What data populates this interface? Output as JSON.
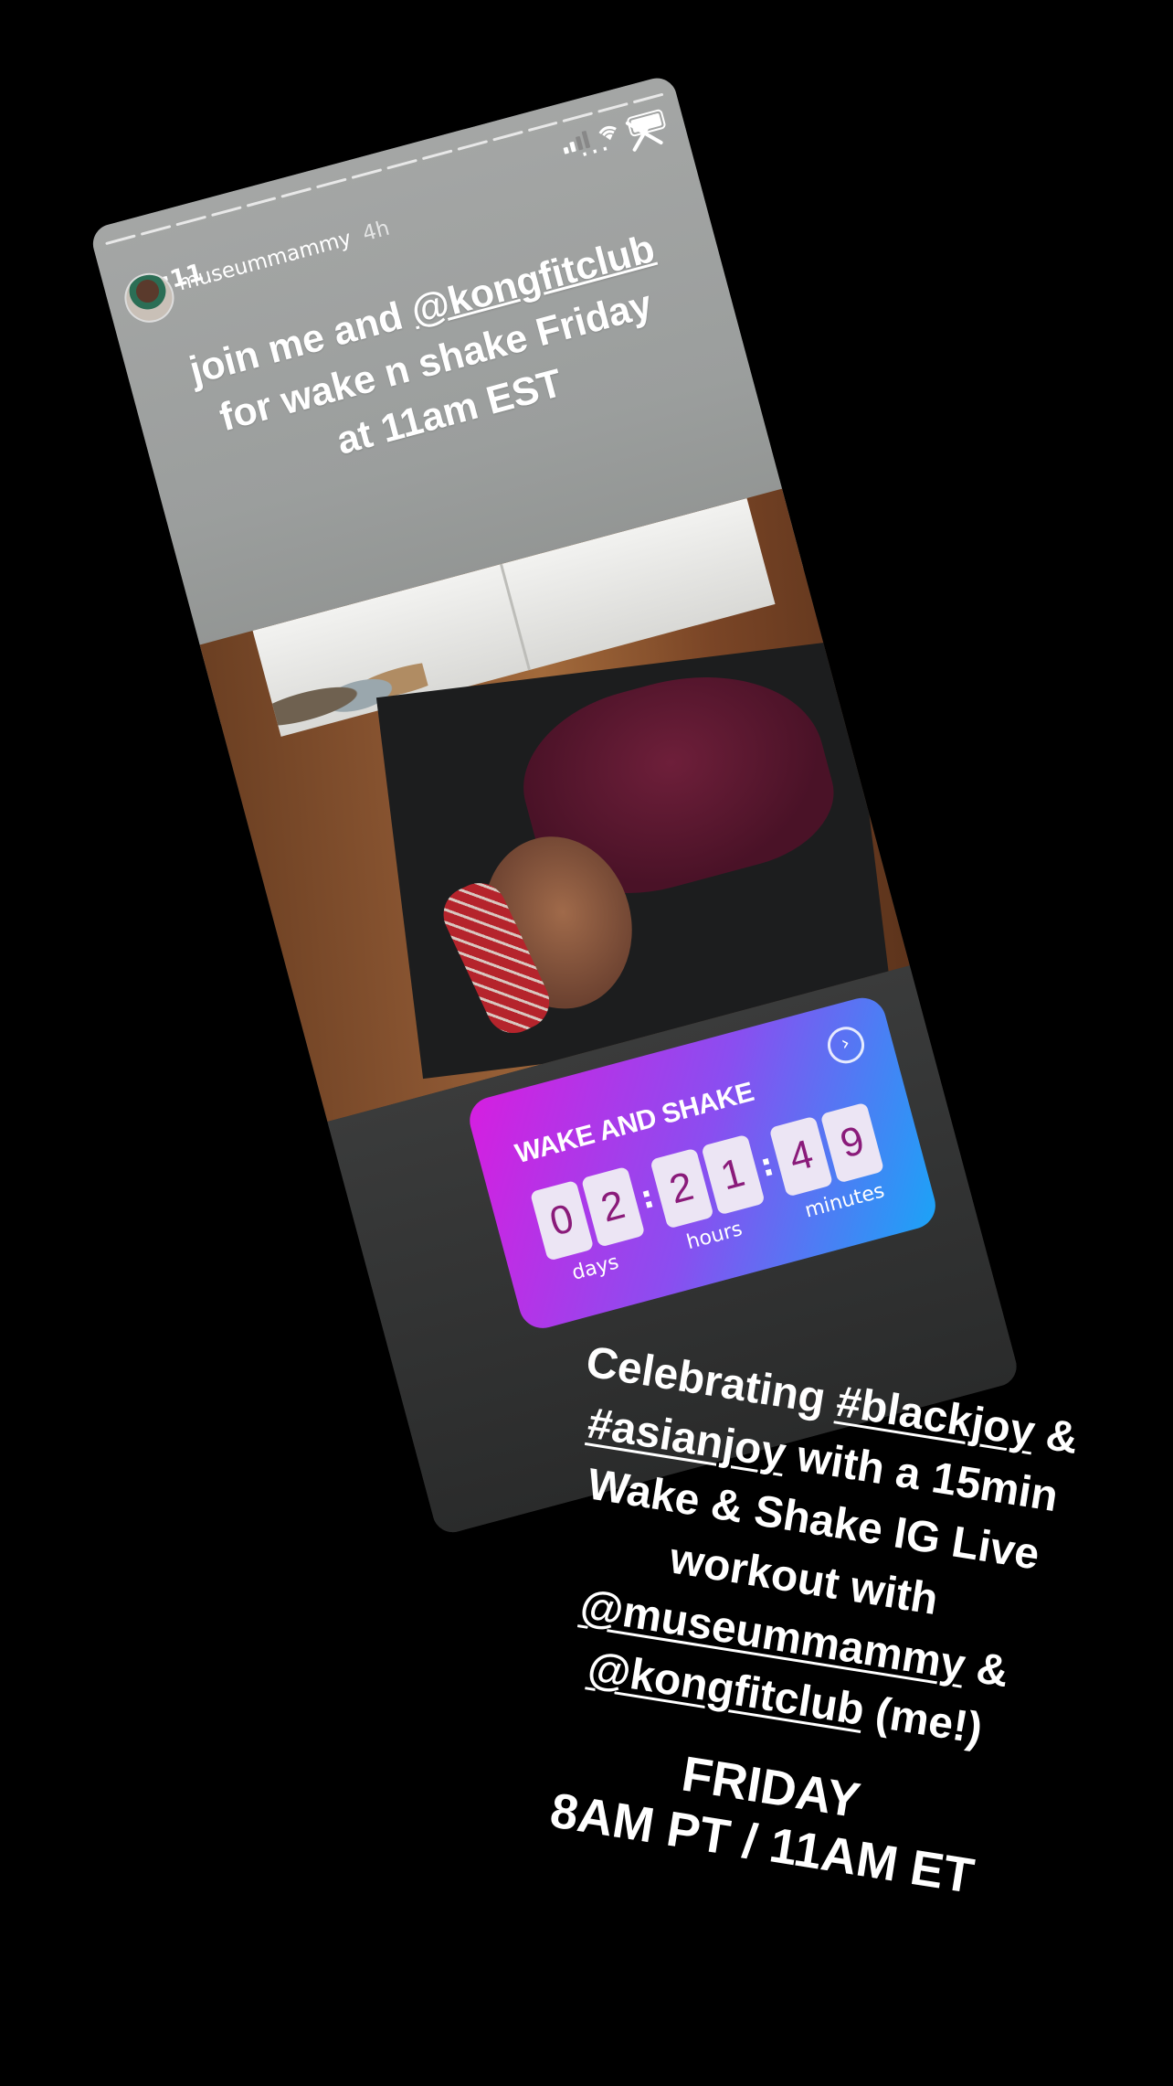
{
  "status_bar": {
    "time": "10:11"
  },
  "story": {
    "username": "museummammy",
    "time_ago": "4h",
    "more": "···",
    "caption": {
      "line1_pre": "join me and ",
      "line1_handle": "@kongfitclub",
      "line2": "for wake n shake Friday",
      "line3": "at 11am EST"
    },
    "countdown": {
      "title": "WAKE AND SHAKE",
      "days": [
        "0",
        "2"
      ],
      "hours": [
        "2",
        "1"
      ],
      "minutes": [
        "4",
        "9"
      ],
      "labels": {
        "days": "days",
        "hours": "hours",
        "minutes": "minutes"
      },
      "colors": {
        "gradient_start": "#d61ee0",
        "gradient_end": "#1aa4f7",
        "digit_text": "#8a1b7a"
      }
    }
  },
  "overlay": {
    "l1_pre": "Celebrating ",
    "l1_tag": "#blackjoy",
    "l1_post": " &",
    "l2_tag": "#asianjoy",
    "l2_post": " with a 15min",
    "l3": "Wake & Shake IG Live",
    "l4": "workout with",
    "l5_handle": "@museummammy",
    "l5_post": " &",
    "l6_handle": "@kongfitclub",
    "l6_post": " (me!)",
    "l7": "FRIDAY",
    "l8": "8AM PT / 11AM ET"
  }
}
